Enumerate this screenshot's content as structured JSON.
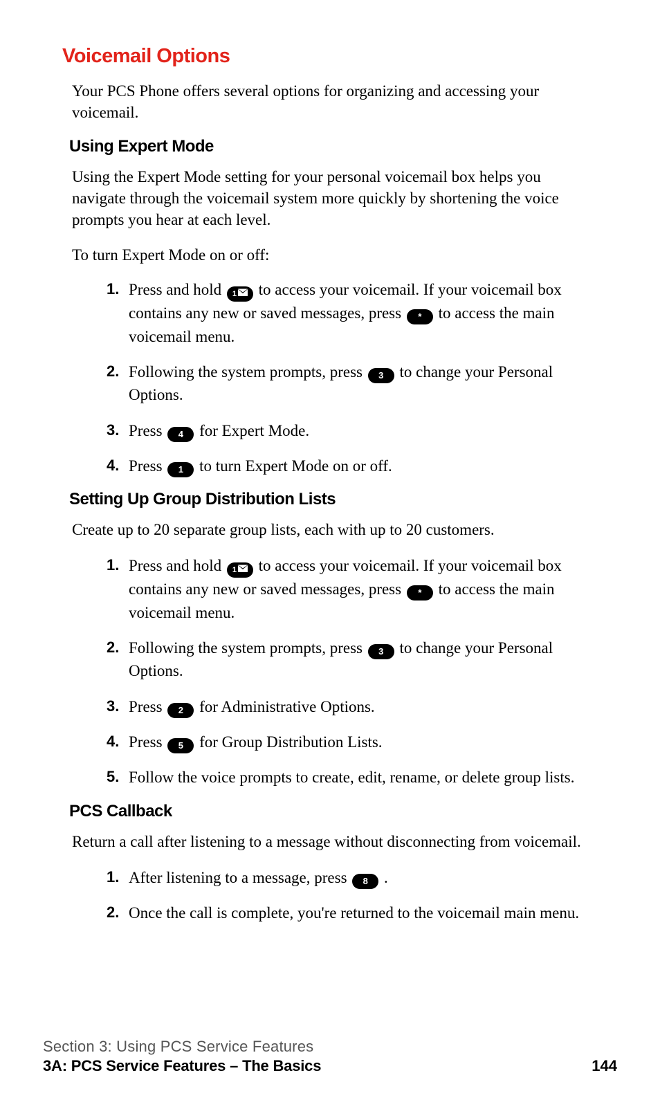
{
  "title": "Voicemail Options",
  "intro": "Your PCS Phone offers several options for organizing and accessing your voicemail.",
  "expert": {
    "heading": "Using Expert Mode",
    "desc": "Using the Expert Mode setting for your personal voicemail box helps you navigate through the voicemail system more quickly by shortening the voice prompts you hear at each level.",
    "prompt": "To turn Expert Mode on or off:",
    "steps": {
      "s1a": "Press and hold ",
      "s1b": " to access your voicemail. If your voicemail box contains any new or saved messages, press ",
      "s1c": " to access the main voicemail menu.",
      "s2a": "Following the system prompts, press ",
      "s2b": " to change your Personal Options.",
      "s3a": "Press ",
      "s3b": " for Expert Mode.",
      "s4a": "Press ",
      "s4b": " to turn Expert Mode on or off."
    }
  },
  "groups": {
    "heading": "Setting Up Group Distribution Lists",
    "desc": "Create up to 20 separate group lists, each with up to 20 customers.",
    "steps": {
      "s1a": "Press and hold ",
      "s1b": " to access your voicemail. If your voicemail box contains any new or saved messages, press ",
      "s1c": " to access the main voicemail menu.",
      "s2a": "Following the system prompts, press ",
      "s2b": " to change your Personal Options.",
      "s3a": "Press ",
      "s3b": " for Administrative Options.",
      "s4a": "Press ",
      "s4b": " for Group Distribution Lists.",
      "s5": "Follow the voice prompts to create, edit, rename, or delete group lists."
    }
  },
  "callback": {
    "heading": "PCS Callback",
    "desc": "Return a call after listening to a message without disconnecting from voicemail.",
    "steps": {
      "s1a": "After listening to a message, press ",
      "s1b": " .",
      "s2": "Once the call is complete, you're returned to the voicemail main menu."
    }
  },
  "keys": {
    "one_mail": "1",
    "star": "*",
    "k1": "1",
    "k2": "2",
    "k3": "3",
    "k4": "4",
    "k5": "5",
    "k8": "8"
  },
  "nums": {
    "n1": "1.",
    "n2": "2.",
    "n3": "3.",
    "n4": "4.",
    "n5": "5."
  },
  "footer": {
    "line1": "Section 3: Using PCS Service Features",
    "line2": "3A: PCS Service Features – The Basics",
    "page": "144"
  }
}
